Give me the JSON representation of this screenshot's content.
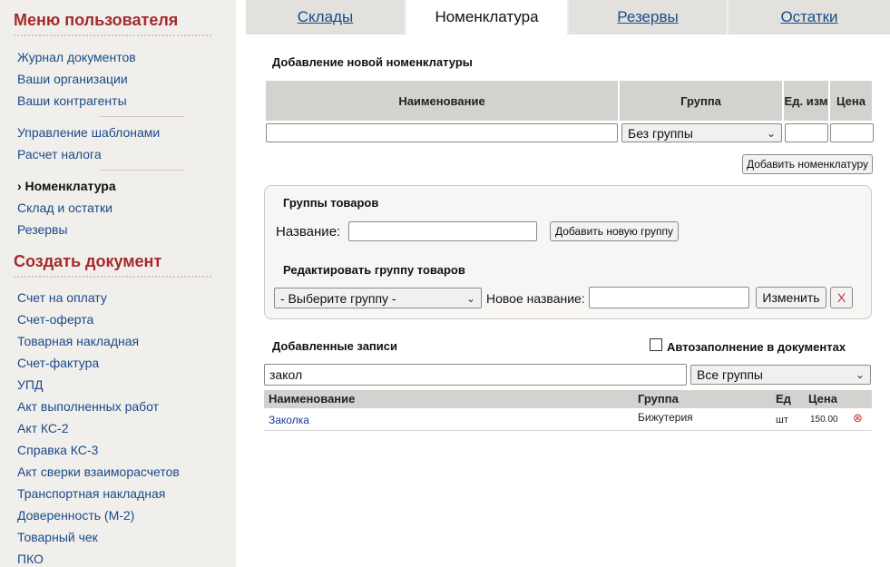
{
  "sidebar": {
    "user_menu_title": "Меню пользователя",
    "items_group1": [
      "Журнал документов",
      "Ваши организации",
      "Ваши контрагенты"
    ],
    "items_group2": [
      "Управление шаблонами",
      "Расчет налога"
    ],
    "items_group3": [
      "› Номенклатура",
      "Склад и остатки",
      "Резервы"
    ],
    "create_title": "Создать документ",
    "create_items": [
      "Счет на оплату",
      "Счет-оферта",
      "Товарная накладная",
      "Счет-фактура",
      "УПД",
      "Акт выполненных работ",
      "Акт КС-2",
      "Справка КС-3",
      "Акт сверки взаиморасчетов",
      "Транспортная накладная",
      "Доверенность (М-2)",
      "Товарный чек",
      "ПКО"
    ]
  },
  "tabs": [
    "Склады",
    "Номенклатура",
    "Резервы",
    "Остатки"
  ],
  "add_form": {
    "title": "Добавление новой номенклатуры",
    "col_name": "Наименование",
    "col_group": "Группа",
    "col_unit": "Ед. изм",
    "col_price": "Цена",
    "name_value": "",
    "group_value": "Без группы",
    "unit_value": "",
    "price_value": "",
    "add_button": "Добавить номенклатуру"
  },
  "groups": {
    "title": "Группы товаров",
    "name_label": "Название:",
    "name_value": "",
    "add_group_button": "Добавить новую группу",
    "edit_title": "Редактировать группу товаров",
    "select_value": "- Выберите группу -",
    "new_name_label": "Новое название:",
    "new_name_value": "",
    "change_button": "Изменить",
    "delete_button": "X"
  },
  "records": {
    "title": "Добавленные записи",
    "autofill_label": "Автозаполнение в документах",
    "search_value": "закол",
    "group_filter_value": "Все группы",
    "headers": {
      "name": "Наименование",
      "group": "Группа",
      "unit": "Ед",
      "price": "Цена"
    },
    "rows": [
      {
        "name": "Заколка",
        "group": "Бижутерия",
        "unit": "шт",
        "price": "150.00"
      }
    ]
  },
  "colors": {
    "accent_heading": "#a52a2a",
    "link": "#1a4a8a",
    "delete_red": "#cc3333"
  }
}
